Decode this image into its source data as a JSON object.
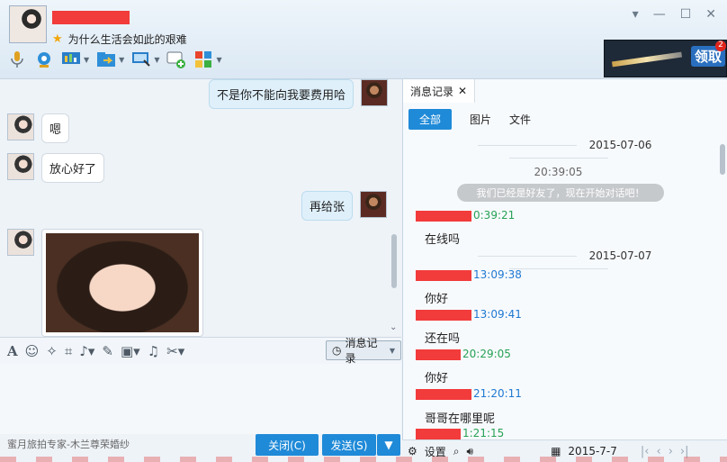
{
  "contact": {
    "signature": "为什么生活会如此的艰难"
  },
  "toolbar": {
    "items": [
      "mic-icon",
      "camera-icon",
      "screen-share-icon",
      "file-transfer-icon",
      "remote-desktop-icon",
      "invite-icon",
      "apps-icon"
    ]
  },
  "ad": {
    "claim": "领取",
    "badge": "2"
  },
  "chat": {
    "messages": [
      {
        "from": "me",
        "text": "不是你不能向我要费用哈"
      },
      {
        "from": "other",
        "text": "嗯"
      },
      {
        "from": "other",
        "text": "放心好了"
      },
      {
        "from": "me",
        "text": "再给张"
      }
    ]
  },
  "input_toolbar": {
    "history_label": "消息记录"
  },
  "footer": {
    "ad_text": "蜜月旅拍专家-木兰尊荣婚纱",
    "close_label": "关闭(C)",
    "send_label": "发送(S)"
  },
  "history": {
    "tab_label": "消息记录",
    "filters": [
      "全部",
      "图片",
      "文件"
    ],
    "date1": "2015-07-06",
    "time_center": "20:39:05",
    "system_msg": "我们已经是好友了，现在开始对话吧！",
    "entries": [
      {
        "time": "0:39:21",
        "text": "在线吗",
        "color": "green"
      },
      {
        "time": "13:09:38",
        "text": "你好",
        "color": "blue"
      },
      {
        "time": "13:09:41",
        "text": "还在吗",
        "color": "blue"
      },
      {
        "time": "20:29:05",
        "text": "你好",
        "color": "green"
      },
      {
        "time": "21:20:11",
        "text": "哥哥在哪里呢",
        "color": "blue"
      },
      {
        "time": "1:21:15",
        "text": "",
        "color": "green"
      }
    ],
    "date2": "2015-07-07",
    "footer_settings": "设置",
    "footer_date": "2015-7-7"
  },
  "colors": {
    "accent": "#1f8ad8",
    "redact": "#f23b3b"
  }
}
